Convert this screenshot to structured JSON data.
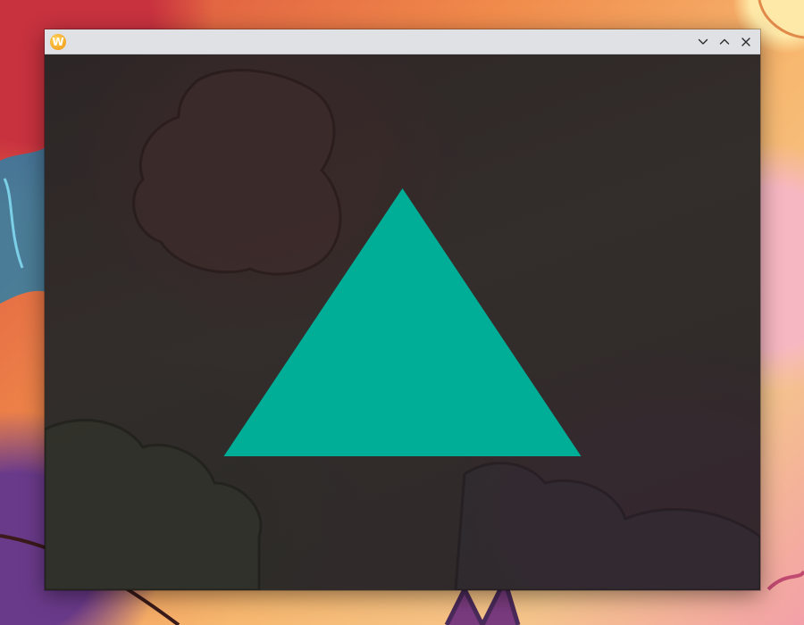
{
  "window": {
    "app_icon_letter": "W",
    "icon": "app-logo-icon",
    "controls": {
      "minimize_icon": "chevron-down-icon",
      "maximize_icon": "chevron-up-icon",
      "close_icon": "close-icon"
    }
  },
  "content": {
    "triangle": {
      "color": "#00ae98",
      "background_color": "#2f2a2a"
    }
  }
}
